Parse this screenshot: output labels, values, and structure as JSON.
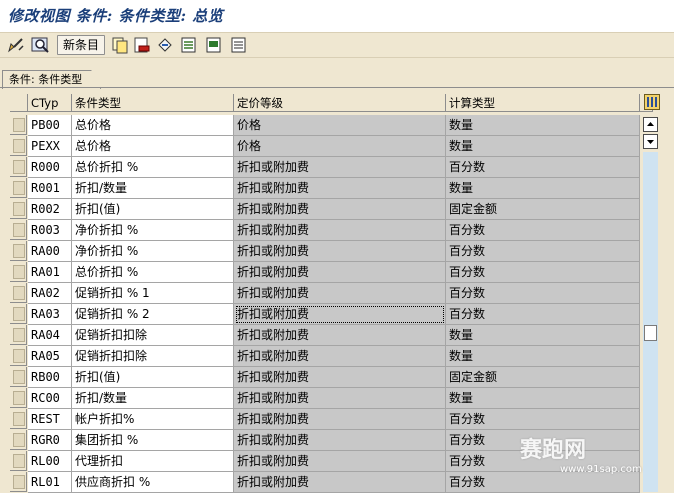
{
  "title": "修改视图 条件: 条件类型: 总览",
  "toolbar": {
    "new_entries_label": "新条目",
    "icons": [
      "display-change-icon",
      "find-icon",
      "copy-icon",
      "delete-icon",
      "undo-icon",
      "select-all-icon",
      "select-block-icon",
      "deselect-all-icon"
    ]
  },
  "tab": {
    "label": "条件: 条件类型"
  },
  "table": {
    "headers": [
      "CTyp",
      "条件类型",
      "定价等级",
      "计算类型"
    ],
    "rows": [
      [
        "PB00",
        "总价格",
        "价格",
        "数量"
      ],
      [
        "PEXX",
        "总价格",
        "价格",
        "数量"
      ],
      [
        "R000",
        "总价折扣 %",
        "折扣或附加费",
        "百分数"
      ],
      [
        "R001",
        "折扣/数量",
        "折扣或附加费",
        "数量"
      ],
      [
        "R002",
        "折扣(值)",
        "折扣或附加费",
        "固定金额"
      ],
      [
        "R003",
        "净价折扣 %",
        "折扣或附加费",
        "百分数"
      ],
      [
        "RA00",
        "净价折扣 %",
        "折扣或附加费",
        "百分数"
      ],
      [
        "RA01",
        "总价折扣 %",
        "折扣或附加费",
        "百分数"
      ],
      [
        "RA02",
        "促销折扣 % 1",
        "折扣或附加费",
        "百分数"
      ],
      [
        "RA03",
        "促销折扣 % 2",
        "折扣或附加费",
        "百分数"
      ],
      [
        "RA04",
        "促销折扣扣除",
        "折扣或附加费",
        "数量"
      ],
      [
        "RA05",
        "促销折扣扣除",
        "折扣或附加费",
        "数量"
      ],
      [
        "RB00",
        "折扣(值)",
        "折扣或附加费",
        "固定金额"
      ],
      [
        "RC00",
        "折扣/数量",
        "折扣或附加费",
        "数量"
      ],
      [
        "REST",
        "帐户折扣%",
        "折扣或附加费",
        "百分数"
      ],
      [
        "RGR0",
        "集团折扣 %",
        "折扣或附加费",
        "百分数"
      ],
      [
        "RL00",
        "代理折扣",
        "折扣或附加费",
        "百分数"
      ],
      [
        "RL01",
        "供应商折扣 %",
        "折扣或附加费",
        "百分数"
      ]
    ]
  },
  "watermark": {
    "text": "赛跑网",
    "sub": "www.91sap.com"
  }
}
